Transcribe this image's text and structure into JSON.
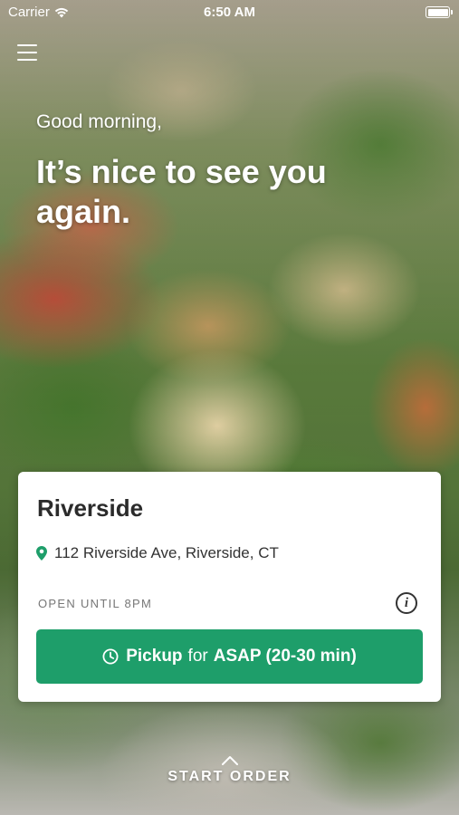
{
  "status_bar": {
    "carrier": "Carrier",
    "time": "6:50 AM",
    "icons": [
      "wifi-icon",
      "battery-icon"
    ]
  },
  "header": {
    "menu_icon": "hamburger-menu-icon"
  },
  "greeting": {
    "small": "Good morning,",
    "big": "It’s nice to see you again."
  },
  "location_card": {
    "name": "Riverside",
    "address": "112 Riverside Ave, Riverside, CT",
    "hours": "OPEN UNTIL 8PM",
    "pickup_button": {
      "prefix": "Pickup",
      "connector": "for",
      "timing": "ASAP (20-30 min)"
    },
    "colors": {
      "accent": "#1e9e6a",
      "pin": "#1e9e6a"
    }
  },
  "footer": {
    "start_order_label": "START ORDER",
    "icon": "chevron-up-icon"
  }
}
